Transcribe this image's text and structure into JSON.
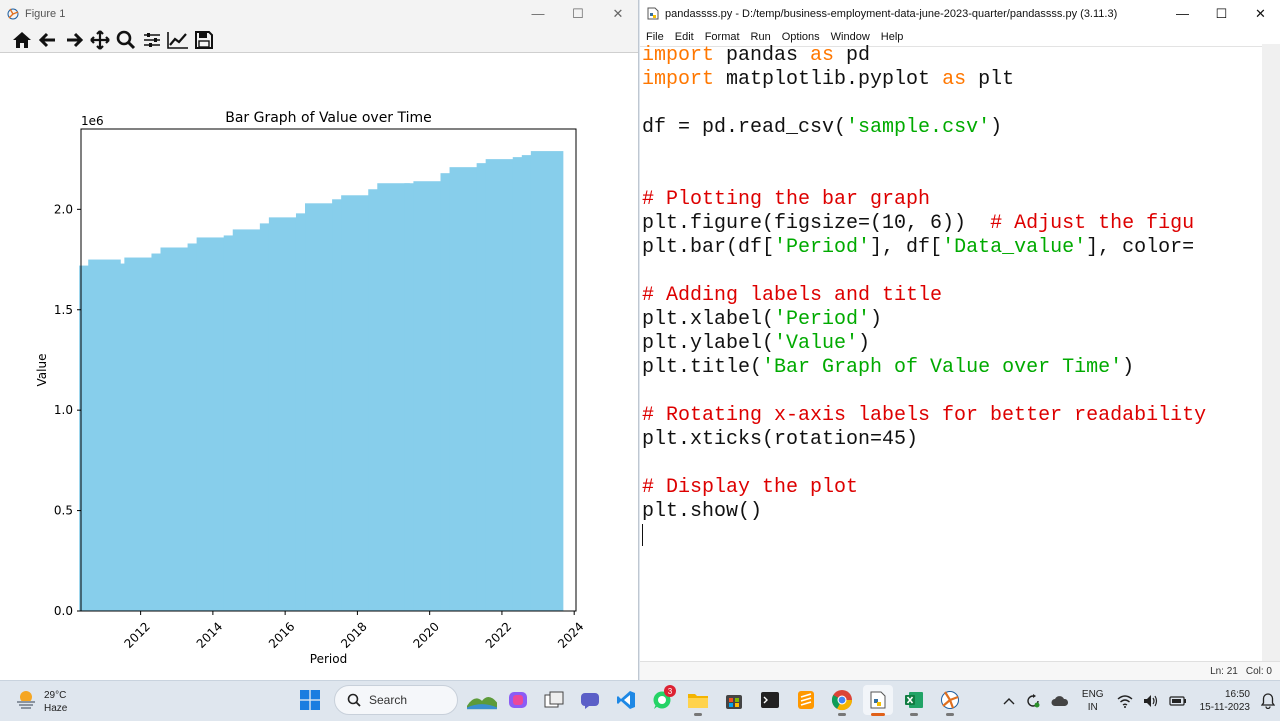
{
  "figure_window": {
    "title": "Figure 1",
    "toolbar": [
      "home-icon",
      "back-icon",
      "forward-icon",
      "pan-icon",
      "zoom-icon",
      "configure-subplots-icon",
      "edit-axis-icon",
      "save-icon"
    ]
  },
  "chart_data": {
    "type": "bar",
    "title": "Bar Graph of Value over Time",
    "xlabel": "Period",
    "ylabel": "Value",
    "offset_label": "1e6",
    "color": "#87ceeb",
    "xticks": [
      "2012",
      "2014",
      "2016",
      "2018",
      "2020",
      "2022",
      "2024"
    ],
    "yticks": [
      "0.0",
      "0.5",
      "1.0",
      "1.5",
      "2.0"
    ],
    "xlim": [
      2010.35,
      2024.05
    ],
    "ylim": [
      0,
      2.4
    ],
    "y_scale": 1000000,
    "bar_width": 0.9,
    "x": [
      2010.75,
      2011.0,
      2011.75,
      2012.0,
      2012.75,
      2013.0,
      2013.75,
      2014.0,
      2014.75,
      2015.0,
      2015.75,
      2016.0,
      2016.75,
      2017.0,
      2017.75,
      2018.0,
      2018.75,
      2019.0,
      2019.75,
      2020.0,
      2020.75,
      2021.0,
      2021.75,
      2022.0,
      2022.75,
      2023.0,
      2023.25
    ],
    "values": [
      1.72,
      1.75,
      1.73,
      1.76,
      1.78,
      1.81,
      1.83,
      1.86,
      1.87,
      1.9,
      1.93,
      1.96,
      1.98,
      2.03,
      2.05,
      2.07,
      2.1,
      2.13,
      2.13,
      2.14,
      2.18,
      2.21,
      2.23,
      2.25,
      2.26,
      2.27,
      2.29
    ]
  },
  "editor_window": {
    "title": "pandassss.py - D:/temp/business-employment-data-june-2023-quarter/pandassss.py (3.11.3)",
    "menu": [
      "File",
      "Edit",
      "Format",
      "Run",
      "Options",
      "Window",
      "Help"
    ],
    "code": {
      "l1_kw1": "import",
      "l1_mod": " pandas ",
      "l1_kw2": "as",
      "l1_alias": " pd",
      "l2_kw1": "import",
      "l2_mod": " matplotlib.pyplot ",
      "l2_kw2": "as",
      "l2_alias": " plt",
      "l4_pre": "df = pd.read_csv(",
      "l4_str": "'sample.csv'",
      "l4_post": ")",
      "l7_cm": "# Plotting the bar graph",
      "l8_pre": "plt.figure(figsize=(10, 6))  ",
      "l8_cm": "# Adjust the figu",
      "l9_a": "plt.bar(df[",
      "l9_s1": "'Period'",
      "l9_b": "], df[",
      "l9_s2": "'Data_value'",
      "l9_c": "], color=",
      "l11_cm": "# Adding labels and title",
      "l12_a": "plt.xlabel(",
      "l12_s": "'Period'",
      "l12_b": ")",
      "l13_a": "plt.ylabel(",
      "l13_s": "'Value'",
      "l13_b": ")",
      "l14_a": "plt.title(",
      "l14_s": "'Bar Graph of Value over Time'",
      "l14_b": ")",
      "l16_cm": "# Rotating x-axis labels for better readability",
      "l17": "plt.xticks(rotation=45)",
      "l19_cm": "# Display the plot",
      "l20": "plt.show()"
    },
    "status": {
      "ln": "Ln: 21",
      "col": "Col: 0"
    }
  },
  "taskbar": {
    "weather": {
      "temp": "29°C",
      "desc": "Haze"
    },
    "search_label": "Search",
    "whatsapp_badge": "3",
    "lang": {
      "l1": "ENG",
      "l2": "IN"
    },
    "time": "16:50",
    "date": "15-11-2023"
  }
}
